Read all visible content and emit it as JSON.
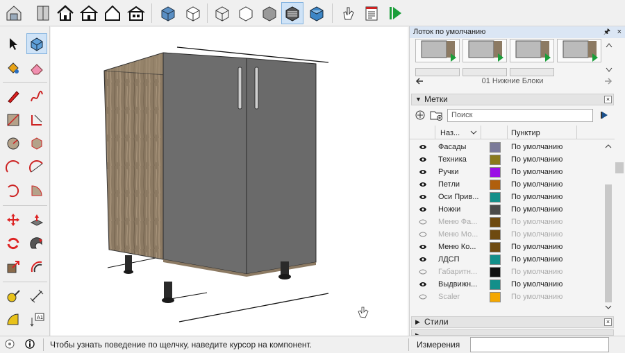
{
  "panel": {
    "title": "Лоток по умолчанию",
    "pin_glyph": "🖈",
    "close_glyph": "×",
    "collection_name": "01 Нижние Блоки"
  },
  "tags": {
    "section_title": "Метки",
    "search_placeholder": "Поиск",
    "col_name": "Наз...",
    "col_dash": "Пунктир",
    "rows": [
      {
        "name": "Фасады",
        "color": "#7b7a99",
        "dash": "По умолчанию",
        "visible": true
      },
      {
        "name": "Техника",
        "color": "#8a7a1b",
        "dash": "По умолчанию",
        "visible": true
      },
      {
        "name": "Ручки",
        "color": "#9a10e6",
        "dash": "По умолчанию",
        "visible": true
      },
      {
        "name": "Петли",
        "color": "#b05f0d",
        "dash": "По умолчанию",
        "visible": true
      },
      {
        "name": "Оси Прив...",
        "color": "#138f8a",
        "dash": "По умолчанию",
        "visible": true
      },
      {
        "name": "Ножки",
        "color": "#4a4a4a",
        "dash": "По умолчанию",
        "visible": true
      },
      {
        "name": "Меню Фа...",
        "color": "#6e4a10",
        "dash": "По умолчанию",
        "visible": false
      },
      {
        "name": "Меню Мо...",
        "color": "#6e4a10",
        "dash": "По умолчанию",
        "visible": false
      },
      {
        "name": "Меню Ко...",
        "color": "#6e4a10",
        "dash": "По умолчанию",
        "visible": true
      },
      {
        "name": "ЛДСП",
        "color": "#138f8a",
        "dash": "По умолчанию",
        "visible": true
      },
      {
        "name": "Габаритн...",
        "color": "#111111",
        "dash": "По умолчанию",
        "visible": false
      },
      {
        "name": "Выдвижн...",
        "color": "#138f8a",
        "dash": "По умолчанию",
        "visible": true
      },
      {
        "name": "Scaler",
        "color": "#f5a800",
        "dash": "По умолчанию",
        "visible": false
      }
    ]
  },
  "styles_section": {
    "title": "Стили"
  },
  "status": {
    "message": "Чтобы узнать поведение по щелчку, наведите курсор на компонент.",
    "measurements_label": "Измерения",
    "measurements_value": ""
  },
  "icons": {
    "top": [
      "warehouse-icon",
      "component-icon",
      "home-icon",
      "house-front-icon",
      "house-outline-icon",
      "house-side-icon",
      "view-iso-icon",
      "view-top-icon",
      "view-front-icon",
      "view-right-icon",
      "view-back-icon",
      "view-left-icon",
      "view-bottom-icon",
      "hand-icon",
      "report-icon",
      "play-next-icon"
    ],
    "left": [
      "select-icon",
      "component-icon",
      "paint-bucket-icon",
      "eraser-icon",
      "pencil-icon",
      "freehand-icon",
      "rectangle-icon",
      "rotated-rectangle-icon",
      "circle-icon",
      "polygon-icon",
      "arc-icon",
      "two-point-arc-icon",
      "three-point-arc-icon",
      "pie-icon",
      "move-icon",
      "push-pull-icon",
      "rotate-icon",
      "follow-me-icon",
      "scale-icon",
      "offset-icon",
      "tape-measure-icon",
      "dimension-icon",
      "protractor-icon",
      "text-icon"
    ]
  },
  "colors": {
    "accent": "#7fb0de",
    "panel_title_bg": "#dbe6f4"
  }
}
